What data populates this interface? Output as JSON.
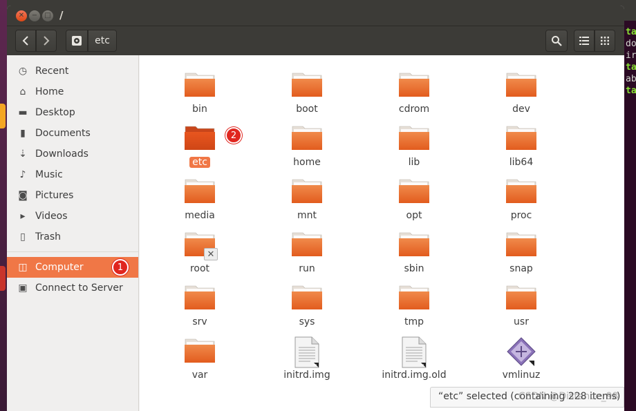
{
  "window": {
    "title": "/"
  },
  "toolbar": {
    "path_current": "etc"
  },
  "sidebar": {
    "places": [
      {
        "label": "Recent",
        "icon": "clock-icon",
        "glyph": "◷"
      },
      {
        "label": "Home",
        "icon": "home-icon",
        "glyph": "⌂"
      },
      {
        "label": "Desktop",
        "icon": "desktop-folder-icon",
        "glyph": "▬"
      },
      {
        "label": "Documents",
        "icon": "documents-icon",
        "glyph": "▮"
      },
      {
        "label": "Downloads",
        "icon": "download-icon",
        "glyph": "⇣"
      },
      {
        "label": "Music",
        "icon": "music-icon",
        "glyph": "♪"
      },
      {
        "label": "Pictures",
        "icon": "camera-icon",
        "glyph": "◙"
      },
      {
        "label": "Videos",
        "icon": "video-icon",
        "glyph": "▸"
      },
      {
        "label": "Trash",
        "icon": "trash-icon",
        "glyph": "▯"
      }
    ],
    "devices": [
      {
        "label": "Computer",
        "icon": "computer-disk-icon",
        "glyph": "◫",
        "selected": true,
        "badge": "1"
      },
      {
        "label": "Connect to Server",
        "icon": "server-icon",
        "glyph": "▣"
      }
    ]
  },
  "files": [
    {
      "name": "bin",
      "type": "folder"
    },
    {
      "name": "boot",
      "type": "folder"
    },
    {
      "name": "cdrom",
      "type": "folder"
    },
    {
      "name": "dev",
      "type": "folder"
    },
    {
      "name": "etc",
      "type": "folder",
      "selected": true,
      "badge": "2"
    },
    {
      "name": "home",
      "type": "folder"
    },
    {
      "name": "lib",
      "type": "folder"
    },
    {
      "name": "lib64",
      "type": "folder"
    },
    {
      "name": "media",
      "type": "folder"
    },
    {
      "name": "mnt",
      "type": "folder"
    },
    {
      "name": "opt",
      "type": "folder"
    },
    {
      "name": "proc",
      "type": "folder"
    },
    {
      "name": "root",
      "type": "folder-locked"
    },
    {
      "name": "run",
      "type": "folder"
    },
    {
      "name": "sbin",
      "type": "folder"
    },
    {
      "name": "snap",
      "type": "folder"
    },
    {
      "name": "srv",
      "type": "folder"
    },
    {
      "name": "sys",
      "type": "folder"
    },
    {
      "name": "tmp",
      "type": "folder"
    },
    {
      "name": "usr",
      "type": "folder"
    },
    {
      "name": "var",
      "type": "folder"
    },
    {
      "name": "initrd.img",
      "type": "link-file"
    },
    {
      "name": "initrd.img.old",
      "type": "link-file"
    },
    {
      "name": "vmlinuz",
      "type": "link-kernel"
    }
  ],
  "status": {
    "text": "“etc” selected  (containing 228 items)"
  },
  "watermark": "CSDN @Distance_98",
  "terminal": [
    "ta",
    "do",
    "ir",
    "ta",
    "ab",
    "ta"
  ],
  "colors": {
    "accent": "#f07746",
    "folder": "#ef6f32",
    "badge": "#e0261f",
    "titlebar": "#3c3b37"
  }
}
